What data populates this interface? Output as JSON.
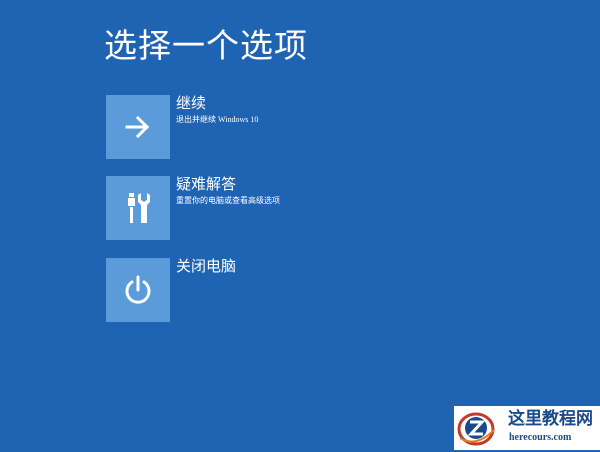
{
  "page": {
    "title": "选择一个选项",
    "background_color": "#1f63b3",
    "tile_color": "#5b9bd9"
  },
  "options": [
    {
      "label": "继续",
      "description": "退出并继续 Windows 10",
      "icon": "arrow-right-icon"
    },
    {
      "label": "疑难解答",
      "description": "重置你的电脑或查看高级选项",
      "icon": "tools-icon"
    },
    {
      "label": "关闭电脑",
      "description": "",
      "icon": "power-icon"
    }
  ],
  "watermark": {
    "name": "这里教程网",
    "url": "herecours.com"
  }
}
